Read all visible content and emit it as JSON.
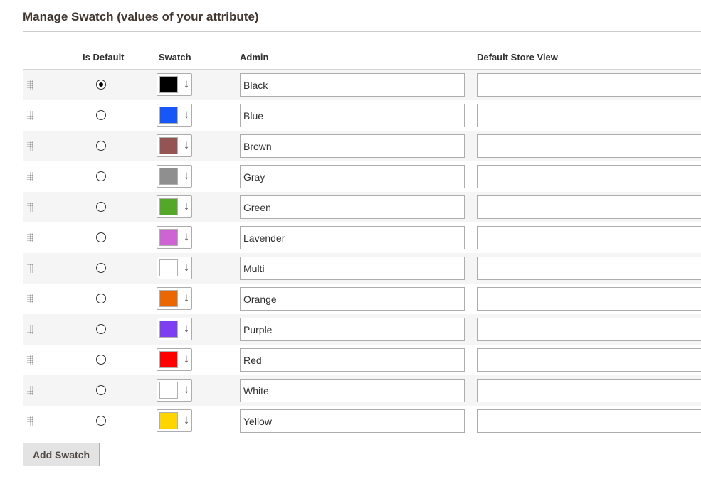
{
  "section": {
    "title": "Manage Swatch (values of your attribute)"
  },
  "columns": {
    "is_default": "Is Default",
    "swatch": "Swatch",
    "admin": "Admin",
    "store_view": "Default Store View"
  },
  "rows": [
    {
      "admin": "Black",
      "store_view": "",
      "color": "#000000",
      "is_default": true
    },
    {
      "admin": "Blue",
      "store_view": "",
      "color": "#1857f7",
      "is_default": false
    },
    {
      "admin": "Brown",
      "store_view": "",
      "color": "#945454",
      "is_default": false
    },
    {
      "admin": "Gray",
      "store_view": "",
      "color": "#8f8f8f",
      "is_default": false
    },
    {
      "admin": "Green",
      "store_view": "",
      "color": "#53a828",
      "is_default": false
    },
    {
      "admin": "Lavender",
      "store_view": "",
      "color": "#ce64d4",
      "is_default": false
    },
    {
      "admin": "Multi",
      "store_view": "",
      "color": "#ffffff",
      "is_default": false
    },
    {
      "admin": "Orange",
      "store_view": "",
      "color": "#eb6703",
      "is_default": false
    },
    {
      "admin": "Purple",
      "store_view": "",
      "color": "#7e3ff2",
      "is_default": false
    },
    {
      "admin": "Red",
      "store_view": "",
      "color": "#ff0000",
      "is_default": false
    },
    {
      "admin": "White",
      "store_view": "",
      "color": "#ffffff",
      "is_default": false
    },
    {
      "admin": "Yellow",
      "store_view": "",
      "color": "#ffd500",
      "is_default": false
    }
  ],
  "swatch_picker_icon": "down-arrow",
  "actions": {
    "add_swatch": "Add Swatch"
  }
}
